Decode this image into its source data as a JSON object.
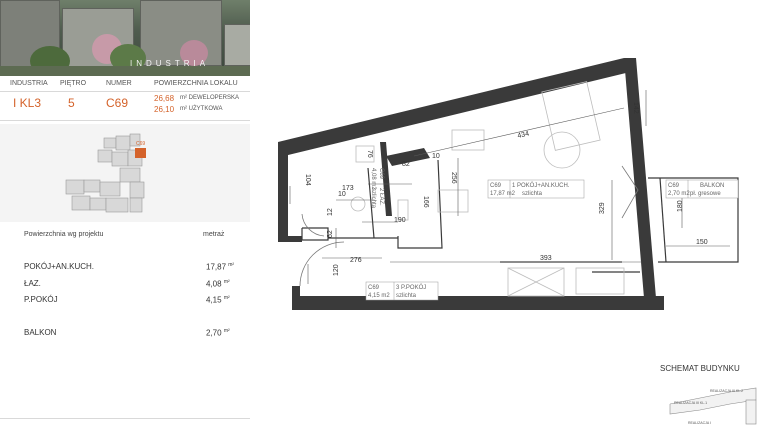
{
  "brand": {
    "name": "INDUSTRIA"
  },
  "header_labels": {
    "investment": "INDUSTRIA",
    "floor": "PIĘTRO",
    "number": "NUMER",
    "area": "POWIERZCHNIA LOKALU"
  },
  "header_values": {
    "investment": "I KL3",
    "floor": "5",
    "number": "C69",
    "area_dev": "26,68",
    "area_dev_suffix": "m² DEWELOPERSKA",
    "area_use": "26,10",
    "area_use_suffix": "m² UŻYTKOWA"
  },
  "keyplan": {
    "unit_tag": "C69"
  },
  "areas_table": {
    "title": "Powierzchnia wg projektu",
    "unit_header": "metraż",
    "rows": [
      {
        "name": "POKÓJ+AN.KUCH.",
        "value": "17,87",
        "unit": "m²"
      },
      {
        "name": "ŁAZ.",
        "value": "4,08",
        "unit": "m²"
      },
      {
        "name": "P.POKÓJ",
        "value": "4,15",
        "unit": "m²"
      }
    ],
    "balcony": {
      "name": "BALKON",
      "value": "2,70",
      "unit": "m²"
    }
  },
  "plan": {
    "rooms": [
      {
        "code": "C69",
        "num_name": "1 POKÓJ+AN.KUCH.",
        "area": "17,87 m2",
        "finish": "szlichta"
      },
      {
        "code": "C69",
        "num_name": "BALKON",
        "area": "2,70 m2",
        "finish": "pł. gresowe"
      },
      {
        "code": "C69",
        "num_name": "3 P.POKÓJ",
        "area": "4,15 m2",
        "finish": "szlichta"
      },
      {
        "code": "C69",
        "num_name": "2 ŁAZ.",
        "area": "4,08 m2",
        "finish": "szlichta"
      }
    ],
    "dims": [
      "434",
      "142",
      "256",
      "329",
      "393",
      "180",
      "150",
      "76",
      "82",
      "10",
      "104",
      "173",
      "166",
      "190",
      "12",
      "62",
      "10",
      "276",
      "120"
    ]
  },
  "schema": {
    "title": "SCHEMAT BUDYNKU",
    "labels": [
      "REALIZACJA III KL.2",
      "REALIZACJA III KL.1",
      "REALIZACJA I"
    ]
  },
  "colors": {
    "accent": "#d4622a",
    "wall": "#3a3a3a"
  }
}
